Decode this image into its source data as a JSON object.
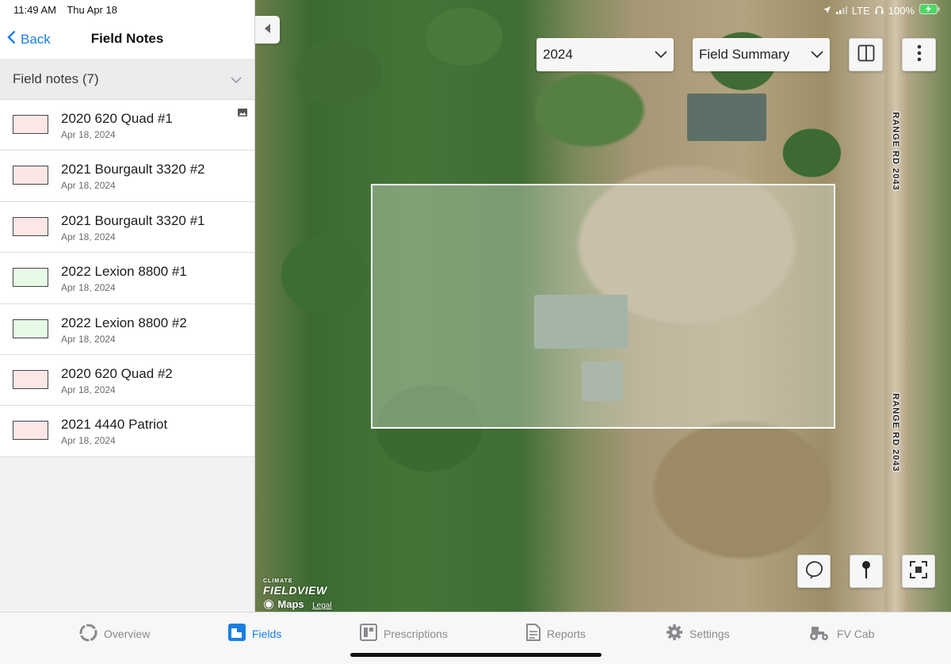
{
  "status_bar": {
    "time": "11:49 AM",
    "date": "Thu Apr 18",
    "network": "LTE",
    "battery": "100%"
  },
  "sidebar": {
    "back_label": "Back",
    "title": "Field Notes",
    "section_label": "Field notes (7)",
    "notes": [
      {
        "title": "2020 620 Quad #1",
        "date": "Apr 18, 2024",
        "color": "#fde6e6",
        "has_photo": true
      },
      {
        "title": "2021 Bourgault 3320 #2",
        "date": "Apr 18, 2024",
        "color": "#fde6e6"
      },
      {
        "title": "2021 Bourgault 3320 #1",
        "date": "Apr 18, 2024",
        "color": "#fde6e6"
      },
      {
        "title": "2022 Lexion 8800 #1",
        "date": "Apr 18, 2024",
        "color": "#e6fbe6"
      },
      {
        "title": "2022 Lexion 8800 #2",
        "date": "Apr 18, 2024",
        "color": "#e6fbe6"
      },
      {
        "title": "2020 620 Quad #2",
        "date": "Apr 18, 2024",
        "color": "#fde6e6"
      },
      {
        "title": "2021 4440 Patriot",
        "date": "Apr 18, 2024",
        "color": "#fde6e6"
      }
    ]
  },
  "map": {
    "year_select": "2024",
    "view_select": "Field Summary",
    "road_label": "RANGE RD 2043",
    "attribution": {
      "climate": "CLIMATE",
      "fieldview": "FIELDVIEW",
      "maps": "Maps",
      "legal": "Legal"
    },
    "icons": [
      "split-view-icon",
      "more-vertical-icon",
      "lasso-icon",
      "pin-icon",
      "fullscreen-icon"
    ]
  },
  "tabs": [
    {
      "label": "Overview",
      "icon": "overview-icon",
      "active": false
    },
    {
      "label": "Fields",
      "icon": "fields-icon",
      "active": true
    },
    {
      "label": "Prescriptions",
      "icon": "prescriptions-icon",
      "active": false
    },
    {
      "label": "Reports",
      "icon": "reports-icon",
      "active": false
    },
    {
      "label": "Settings",
      "icon": "gear-icon",
      "active": false
    },
    {
      "label": "FV Cab",
      "icon": "tractor-icon",
      "active": false
    }
  ],
  "colors": {
    "accent": "#1a7fe0",
    "inactive": "#8a8a8e"
  }
}
